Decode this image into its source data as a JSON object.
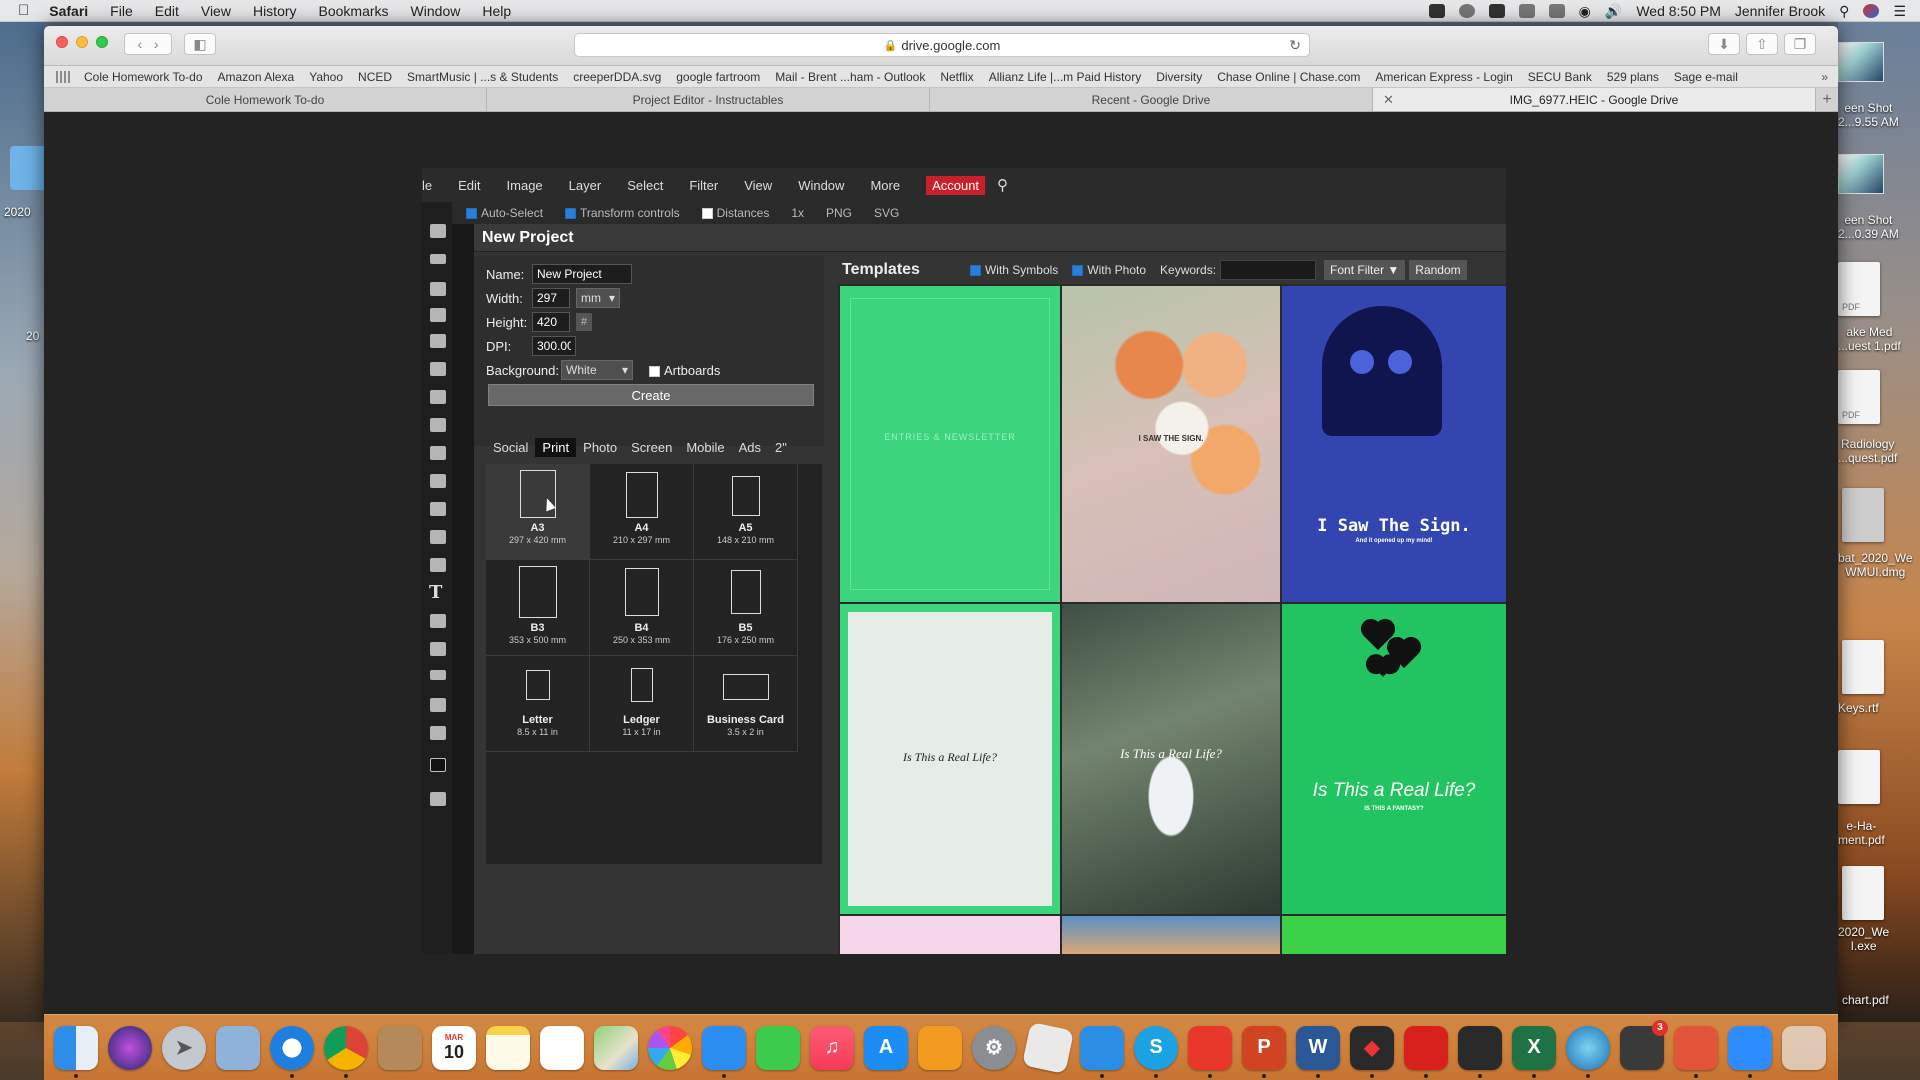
{
  "menubar": {
    "app": "Safari",
    "items": [
      "File",
      "Edit",
      "View",
      "History",
      "Bookmarks",
      "Window",
      "Help"
    ],
    "clock": "Wed 8:50 PM",
    "user": "Jennifer Brook"
  },
  "desktop": {
    "left_labels": [
      "2020",
      "20"
    ],
    "right_labels": [
      "een Shot\n2...9.55 AM",
      "een Shot\n2...0.39 AM",
      "ake Med\n...uest 1.pdf",
      "Radiology\n...quest.pdf",
      "bat_2020_We\nWMUI.dmg",
      "Keys.rtf",
      "e-Ha-\nment.pdf",
      "2020_We\nI.exe",
      "chart.pdf"
    ],
    "file_badge": "PDF"
  },
  "browser": {
    "url": "drive.google.com",
    "bookmarks": [
      "Cole Homework To-do",
      "Amazon Alexa",
      "Yahoo",
      "NCED",
      "SmartMusic | ...s & Students",
      "creeperDDA.svg",
      "google fartroom",
      "Mail - Brent ...ham - Outlook",
      "Netflix",
      "Allianz Life |...m Paid History",
      "Diversity",
      "Chase Online | Chase.com",
      "American Express - Login",
      "SECU Bank",
      "529 plans",
      "Sage e-mail"
    ],
    "tabs": [
      "Cole Homework To-do",
      "Project Editor - Instructables",
      "Recent - Google Drive",
      "IMG_6977.HEIC - Google Drive"
    ],
    "active_tab": 3
  },
  "editor": {
    "menu": [
      "le",
      "Edit",
      "Image",
      "Layer",
      "Select",
      "Filter",
      "View",
      "Window",
      "More",
      "Account"
    ],
    "options": [
      "Auto-Select",
      "Transform controls",
      "Distances",
      "1x",
      "PNG",
      "SVG"
    ],
    "dialog_title": "New Project",
    "form": {
      "name_label": "Name:",
      "name_value": "New Project",
      "width_label": "Width:",
      "width_value": "297",
      "unit": "mm",
      "height_label": "Height:",
      "height_value": "420",
      "hash": "#",
      "dpi_label": "DPI:",
      "dpi_value": "300.000",
      "background_label": "Background:",
      "background_value": "White",
      "artboards_label": "Artboards",
      "create_label": "Create"
    },
    "categories": [
      "Social",
      "Print",
      "Photo",
      "Screen",
      "Mobile",
      "Ads",
      "2\""
    ],
    "active_category": 1,
    "presets": [
      {
        "name": "A3",
        "size": "297 x 420 mm"
      },
      {
        "name": "A4",
        "size": "210 x 297 mm"
      },
      {
        "name": "A5",
        "size": "148 x 210 mm"
      },
      {
        "name": "B3",
        "size": "353 x 500 mm"
      },
      {
        "name": "B4",
        "size": "250 x 353 mm"
      },
      {
        "name": "B5",
        "size": "176 x 250 mm"
      },
      {
        "name": "Letter",
        "size": "8.5 x 11 in"
      },
      {
        "name": "Ledger",
        "size": "11 x 17 in"
      },
      {
        "name": "Business Card",
        "size": "3.5 x 2 in"
      }
    ],
    "templates": {
      "title": "Templates",
      "with_symbols": "With Symbols",
      "with_photo": "With Photo",
      "keywords_label": "Keywords:",
      "font_filter": "Font Filter",
      "random": "Random",
      "card1_title": "ENTRIES & NEWSLETTER",
      "card2_title": "I SAW THE SIGN.",
      "card3_title": "I Saw The Sign.",
      "card3_subtitle": "And it opened up my mind!",
      "card4_title": "Is This a Real Life?",
      "card5_title": "Is This a Real Life?",
      "card6_title": "Is This a Real Life?",
      "card6_subtitle": "IS THIS A FANTASY?"
    }
  },
  "dock": {
    "apps": [
      "finder-icon",
      "siri-icon",
      "launchpad-icon",
      "preview-icon",
      "safari-icon",
      "chrome-icon",
      "contacts-icon",
      "calendar-icon",
      "notes-icon",
      "reminders-icon",
      "maps-icon",
      "photos-icon",
      "messages-icon",
      "facetime-icon",
      "music-icon",
      "app-store-icon",
      "books-icon",
      "settings-icon",
      "roblox-icon",
      "testflight-icon",
      "skype-icon",
      "pdf-icon",
      "powerpoint-icon",
      "word-icon",
      "shield-icon",
      "acrobat-icon",
      "acrobat-reader-icon",
      "excel-icon",
      "edge-icon",
      "printer-icon",
      "teamviewer-icon",
      "zoom-icon",
      "trash-icon"
    ],
    "calendar_month": "MAR",
    "calendar_day": "10",
    "printer_badge": "3"
  },
  "colors": {
    "account_red": "#c9202b",
    "template_green": "#3dd47e",
    "ghost_blue": "#3346b0"
  }
}
